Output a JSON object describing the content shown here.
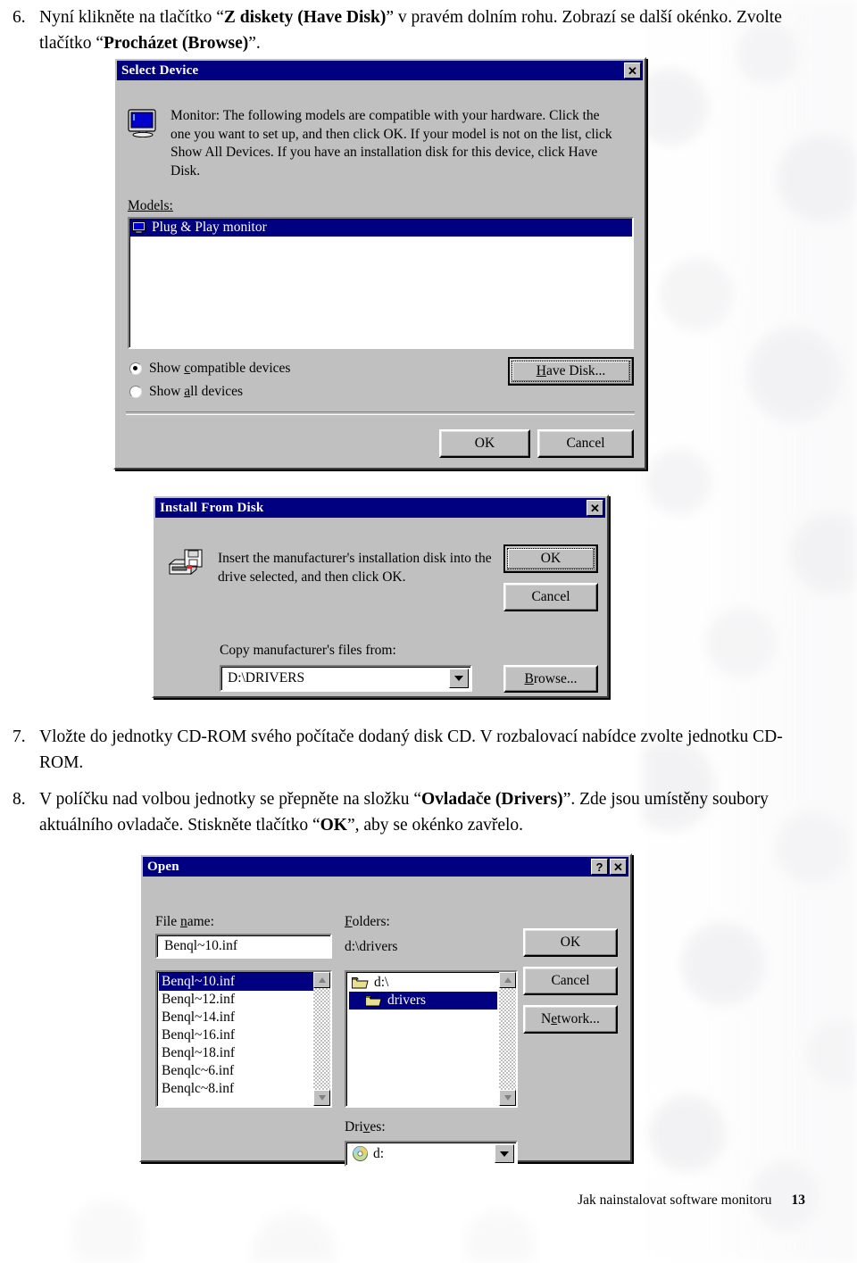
{
  "document": {
    "steps": [
      {
        "number": "6.",
        "line1_pre": "Nyní klikněte na tlačítko “",
        "line1_bold": "Z diskety (Have Disk)",
        "line1_post": "” v pravém dolním rohu. Zobrazí se další",
        "line2_pre": "okénko. Zvolte tlačítko “",
        "line2_bold": "Procházet (Browse)",
        "line2_post": "”."
      },
      {
        "number": "7.",
        "text": "Vložte do jednotky CD-ROM svého počítače dodaný disk CD. V rozbalovací nabídce zvolte jednotku CD-ROM."
      },
      {
        "number": "8.",
        "pre": "V políčku nad volbou jednotky se přepněte na složku “",
        "bold1": "Ovladače (Drivers)",
        "mid": "”. Zde jsou umístěny soubory aktuálního ovladače. Stiskněte tlačítko “",
        "bold2": "OK",
        "post": "”, aby se okénko zavřelo."
      }
    ],
    "footer": {
      "text": "Jak nainstalovat software monitoru",
      "page": "13"
    }
  },
  "select_device_dialog": {
    "title": "Select Device",
    "close_button": "✕",
    "icon": "monitor-icon",
    "description": "Monitor: The following models are compatible with your hardware. Click the one you want to set up, and then click OK. If your model is not on the list, click Show All Devices. If you have an installation disk for this device, click Have Disk.",
    "models_label": "Models:",
    "models": [
      {
        "name": "Plug & Play monitor",
        "selected": true
      }
    ],
    "radios": [
      {
        "label_pre": "Show ",
        "label_key": "c",
        "label_post": "ompatible devices",
        "checked": true
      },
      {
        "label_pre": "Show ",
        "label_key": "a",
        "label_post": "ll devices",
        "checked": false
      }
    ],
    "have_disk_button": {
      "pre": "",
      "key": "H",
      "post": "ave Disk..."
    },
    "ok_button": "OK",
    "cancel_button": "Cancel"
  },
  "install_from_disk_dialog": {
    "title": "Install From Disk",
    "close_button": "✕",
    "icon": "floppy-drive-icon",
    "description": "Insert the manufacturer's installation disk into the drive selected, and then click OK.",
    "copy_from_label": "Copy manufacturer's files from:",
    "path_value": "D:\\DRIVERS",
    "ok_button": "OK",
    "cancel_button": "Cancel",
    "browse_button": {
      "key": "B",
      "post": "rowse..."
    }
  },
  "open_dialog": {
    "title": "Open",
    "help_button": "?",
    "close_button": "✕",
    "file_name_label": {
      "pre": "File ",
      "key": "n",
      "post": "ame:"
    },
    "file_name_value": "Benql~10.inf",
    "files": [
      {
        "name": "Benql~10.inf",
        "selected": true
      },
      {
        "name": "Benql~12.inf",
        "selected": false
      },
      {
        "name": "Benql~14.inf",
        "selected": false
      },
      {
        "name": "Benql~16.inf",
        "selected": false
      },
      {
        "name": "Benql~18.inf",
        "selected": false
      },
      {
        "name": "Benqlc~6.inf",
        "selected": false
      },
      {
        "name": "Benqlc~8.inf",
        "selected": false
      }
    ],
    "folders_label": {
      "pre": "",
      "key": "F",
      "post": "olders:"
    },
    "current_path": "d:\\drivers",
    "folders": [
      {
        "name": "d:\\",
        "indent": 0,
        "selected": false
      },
      {
        "name": "drivers",
        "indent": 1,
        "selected": true
      }
    ],
    "drives_label": {
      "pre": "Dri",
      "key": "v",
      "post": "es:"
    },
    "drive_value": "d:",
    "ok_button": "OK",
    "cancel_button": "Cancel",
    "network_button": {
      "pre": "N",
      "key": "e",
      "post": "twork..."
    }
  },
  "colors": {
    "titlebar": "#000080",
    "dialog_face": "#c0c0c0",
    "selection": "#000080",
    "selection_text": "#ffffff"
  }
}
